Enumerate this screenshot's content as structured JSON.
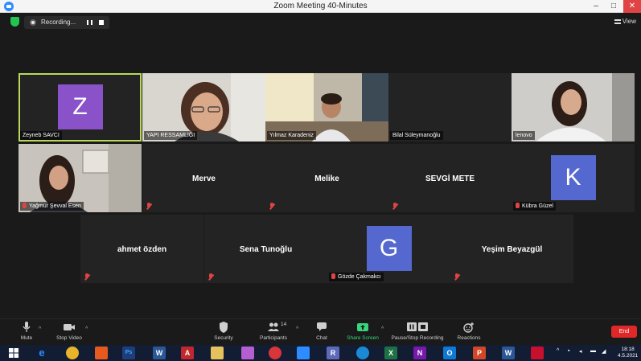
{
  "window": {
    "title": "Zoom Meeting 40-Minutes",
    "min_label": "–",
    "max_label": "□",
    "close_label": "✕"
  },
  "topbar": {
    "recording_label": "Recording...",
    "view_label": "View"
  },
  "participants": {
    "row1": [
      {
        "name": "Zeyneb SAVCI",
        "initial": "Z",
        "active": true
      },
      {
        "name": "YAPI RESSAMLIĞI"
      },
      {
        "name": "Yılmaz Karadeniz"
      },
      {
        "name": "Bilal Süleymanoğlu"
      },
      {
        "name": "lenovo"
      }
    ],
    "row2": [
      {
        "name": "Yağmur Şevval Esen"
      },
      {
        "name": "Merve"
      },
      {
        "name": "Melike"
      },
      {
        "name": "SEVGİ METE"
      },
      {
        "name": "Kübra Güzel",
        "initial": "K"
      }
    ],
    "row3": [
      {
        "name": "ahmet özden"
      },
      {
        "name": "Sena Tunoğlu"
      },
      {
        "name": "Gözde Çakmakcı",
        "initial": "G"
      },
      {
        "name": "Yeşim Beyazgül"
      }
    ]
  },
  "toolbar": {
    "mute": "Mute",
    "stop_video": "Stop Video",
    "security": "Security",
    "participants": "Participants",
    "participants_count": "14",
    "chat": "Chat",
    "share_screen": "Share Screen",
    "pause_stop_recording": "Pause/Stop Recording",
    "reactions": "Reactions",
    "end": "End"
  },
  "taskbar": {
    "time": "18:18",
    "date": "4.5.2021"
  },
  "colors": {
    "avatar_purple": "#8a52c9",
    "avatar_blue": "#5468cf",
    "active_border": "#b8d95a",
    "end_red": "#e02828",
    "share_green": "#37d67a"
  }
}
